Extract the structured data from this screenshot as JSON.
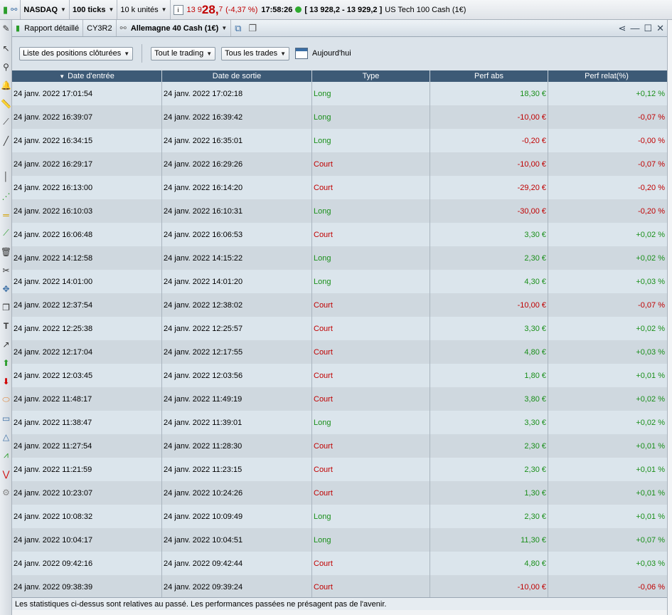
{
  "topbar": {
    "symbol": "NASDAQ",
    "ticks": "100 ticks",
    "units": "10 k unités",
    "price_prefix": "13 9",
    "price_main": "28,",
    "price_sup": "7",
    "change": "(-4,37 %)",
    "time": "17:58:26",
    "bid_ask": "[ 13 928,2 - 13 929,2 ]",
    "instrument": "US Tech 100 Cash (1€)"
  },
  "window": {
    "report_label": "Rapport détaillé",
    "account": "CY3R2",
    "instrument": "Allemagne 40 Cash (1€)"
  },
  "filters": {
    "closed_positions": "Liste des positions clôturées",
    "trading": "Tout le trading",
    "trades": "Tous les trades",
    "today": "Aujourd'hui"
  },
  "table": {
    "headers": [
      "Date d'entrée",
      "Date de sortie",
      "Type",
      "Perf abs",
      "Perf relat(%)"
    ],
    "rows": [
      {
        "entry": "24 janv. 2022 17:01:54",
        "exit": "24 janv. 2022 17:02:18",
        "type": "Long",
        "abs": "18,30 €",
        "rel": "+0,12 %"
      },
      {
        "entry": "24 janv. 2022 16:39:07",
        "exit": "24 janv. 2022 16:39:42",
        "type": "Long",
        "abs": "-10,00 €",
        "rel": "-0,07 %"
      },
      {
        "entry": "24 janv. 2022 16:34:15",
        "exit": "24 janv. 2022 16:35:01",
        "type": "Long",
        "abs": "-0,20 €",
        "rel": "-0,00 %"
      },
      {
        "entry": "24 janv. 2022 16:29:17",
        "exit": "24 janv. 2022 16:29:26",
        "type": "Court",
        "abs": "-10,00 €",
        "rel": "-0,07 %"
      },
      {
        "entry": "24 janv. 2022 16:13:00",
        "exit": "24 janv. 2022 16:14:20",
        "type": "Court",
        "abs": "-29,20 €",
        "rel": "-0,20 %"
      },
      {
        "entry": "24 janv. 2022 16:10:03",
        "exit": "24 janv. 2022 16:10:31",
        "type": "Long",
        "abs": "-30,00 €",
        "rel": "-0,20 %"
      },
      {
        "entry": "24 janv. 2022 16:06:48",
        "exit": "24 janv. 2022 16:06:53",
        "type": "Court",
        "abs": "3,30 €",
        "rel": "+0,02 %"
      },
      {
        "entry": "24 janv. 2022 14:12:58",
        "exit": "24 janv. 2022 14:15:22",
        "type": "Long",
        "abs": "2,30 €",
        "rel": "+0,02 %"
      },
      {
        "entry": "24 janv. 2022 14:01:00",
        "exit": "24 janv. 2022 14:01:20",
        "type": "Long",
        "abs": "4,30 €",
        "rel": "+0,03 %"
      },
      {
        "entry": "24 janv. 2022 12:37:54",
        "exit": "24 janv. 2022 12:38:02",
        "type": "Court",
        "abs": "-10,00 €",
        "rel": "-0,07 %"
      },
      {
        "entry": "24 janv. 2022 12:25:38",
        "exit": "24 janv. 2022 12:25:57",
        "type": "Court",
        "abs": "3,30 €",
        "rel": "+0,02 %"
      },
      {
        "entry": "24 janv. 2022 12:17:04",
        "exit": "24 janv. 2022 12:17:55",
        "type": "Court",
        "abs": "4,80 €",
        "rel": "+0,03 %"
      },
      {
        "entry": "24 janv. 2022 12:03:45",
        "exit": "24 janv. 2022 12:03:56",
        "type": "Court",
        "abs": "1,80 €",
        "rel": "+0,01 %"
      },
      {
        "entry": "24 janv. 2022 11:48:17",
        "exit": "24 janv. 2022 11:49:19",
        "type": "Court",
        "abs": "3,80 €",
        "rel": "+0,02 %"
      },
      {
        "entry": "24 janv. 2022 11:38:47",
        "exit": "24 janv. 2022 11:39:01",
        "type": "Long",
        "abs": "3,30 €",
        "rel": "+0,02 %"
      },
      {
        "entry": "24 janv. 2022 11:27:54",
        "exit": "24 janv. 2022 11:28:30",
        "type": "Court",
        "abs": "2,30 €",
        "rel": "+0,01 %"
      },
      {
        "entry": "24 janv. 2022 11:21:59",
        "exit": "24 janv. 2022 11:23:15",
        "type": "Court",
        "abs": "2,30 €",
        "rel": "+0,01 %"
      },
      {
        "entry": "24 janv. 2022 10:23:07",
        "exit": "24 janv. 2022 10:24:26",
        "type": "Court",
        "abs": "1,30 €",
        "rel": "+0,01 %"
      },
      {
        "entry": "24 janv. 2022 10:08:32",
        "exit": "24 janv. 2022 10:09:49",
        "type": "Long",
        "abs": "2,30 €",
        "rel": "+0,01 %"
      },
      {
        "entry": "24 janv. 2022 10:04:17",
        "exit": "24 janv. 2022 10:04:51",
        "type": "Long",
        "abs": "11,30 €",
        "rel": "+0,07 %"
      },
      {
        "entry": "24 janv. 2022 09:42:16",
        "exit": "24 janv. 2022 09:42:44",
        "type": "Court",
        "abs": "4,80 €",
        "rel": "+0,03 %"
      },
      {
        "entry": "24 janv. 2022 09:38:39",
        "exit": "24 janv. 2022 09:39:24",
        "type": "Court",
        "abs": "-10,00 €",
        "rel": "-0,06 %"
      }
    ]
  },
  "footer": {
    "disclaimer": "Les statistiques ci-dessus sont relatives au passé. Les performances passées ne présagent pas de l'avenir."
  },
  "colors": {
    "header_bg": "#3d5a76",
    "positive": "#1a8f1a",
    "negative": "#c00000"
  }
}
